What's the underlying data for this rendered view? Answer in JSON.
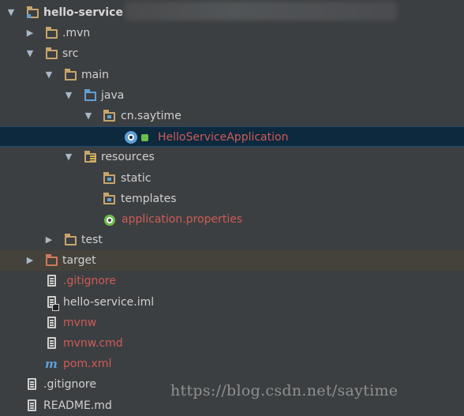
{
  "tree": {
    "root": {
      "label": "hello-service",
      "expanded": true
    },
    "items": [
      {
        "label": "hello-service"
      },
      {
        "label": ".mvn"
      },
      {
        "label": "src"
      },
      {
        "label": "main"
      },
      {
        "label": "java"
      },
      {
        "label": "cn.saytime"
      },
      {
        "label": "HelloServiceApplication"
      },
      {
        "label": "resources"
      },
      {
        "label": "static"
      },
      {
        "label": "templates"
      },
      {
        "label": "application.properties"
      },
      {
        "label": "test"
      },
      {
        "label": "target"
      },
      {
        "label": ".gitignore"
      },
      {
        "label": "hello-service.iml"
      },
      {
        "label": "mvnw"
      },
      {
        "label": "mvnw.cmd"
      },
      {
        "label": "pom.xml"
      },
      {
        "label": ".gitignore"
      },
      {
        "label": "README.md"
      }
    ],
    "arrow_expanded": "▼",
    "arrow_collapsed": "▶"
  },
  "maven_icon_glyph": "m",
  "watermark": "https://blog.csdn.net/saytime",
  "colors": {
    "background": "#3c3f41",
    "selection": "#0d293e",
    "excluded": "#45423b",
    "untracked_text": "#cf5b56",
    "folder": "#c7a56b",
    "source_folder": "#5fa1d6"
  },
  "icons": {
    "folder": "folder-icon",
    "source_folder": "source-folder-icon",
    "package": "package-icon",
    "resources_folder": "resources-folder-icon",
    "excluded_folder": "excluded-folder-icon",
    "file": "text-file-icon",
    "module_file": "module-file-icon",
    "maven": "maven-icon",
    "spring_boot": "spring-boot-icon",
    "lock": "lock-icon"
  }
}
